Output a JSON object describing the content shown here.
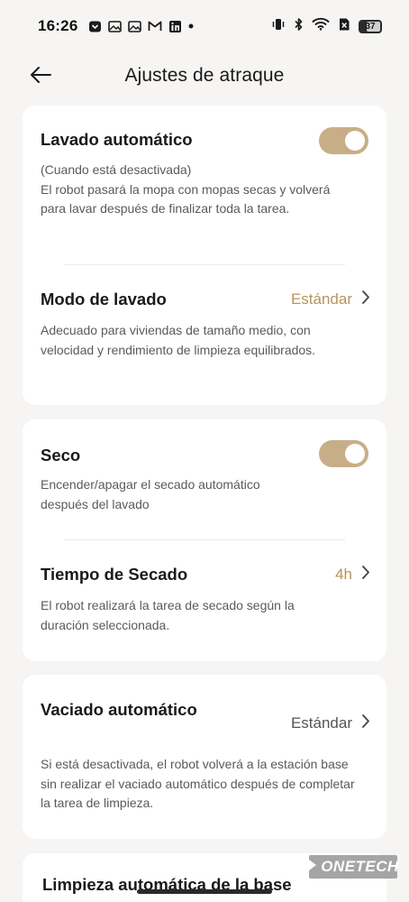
{
  "status_bar": {
    "time": "16:26",
    "battery": "37",
    "notification_icons": [
      "pocket-icon",
      "gallery-icon",
      "gallery-icon",
      "gmail-icon",
      "linkedin-icon",
      "dot-icon"
    ],
    "system_icons": [
      "vibrate-icon",
      "bluetooth-icon",
      "wifi-icon",
      "sim-off-icon",
      "battery-icon"
    ]
  },
  "header": {
    "title": "Ajustes de atraque",
    "back_icon": "arrow-left-icon"
  },
  "colors": {
    "accent": "#c8ae88",
    "accent_text": "#b8935e",
    "background": "#f6f5f3",
    "card": "#ffffff"
  },
  "card1": {
    "auto_wash": {
      "title": "Lavado automático",
      "toggle_on": true,
      "desc_line1": "(Cuando está desactivada)",
      "desc_line2": "El robot pasará la mopa con mopas secas y volverá para lavar después de finalizar toda la tarea."
    },
    "wash_mode": {
      "title": "Modo de lavado",
      "value": "Estándar",
      "desc": "Adecuado para viviendas de tamaño medio, con velocidad y rendimiento de limpieza equilibrados."
    }
  },
  "card2": {
    "dry": {
      "title": "Seco",
      "toggle_on": true,
      "desc": "Encender/apagar el secado automático después del lavado"
    },
    "dry_time": {
      "title": "Tiempo de Secado",
      "value": "4h",
      "desc": "El robot realizará la tarea de secado según la duración seleccionada."
    }
  },
  "card3": {
    "auto_empty": {
      "title": "Vaciado automático",
      "value": "Estándar",
      "desc": "Si está desactivada, el robot volverá a la estación base sin realizar el vaciado automático después de completar la tarea de limpieza."
    }
  },
  "card4": {
    "partial_title": "Limpieza automática de la base"
  },
  "watermark": {
    "text": "ONETECH"
  }
}
